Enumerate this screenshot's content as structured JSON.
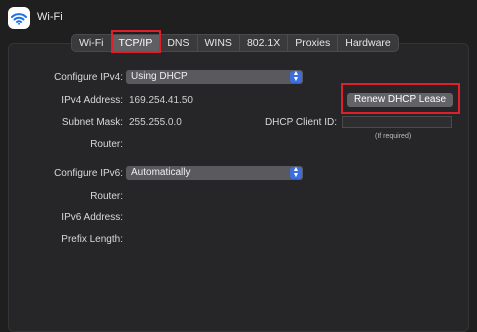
{
  "header": {
    "title": "Wi-Fi",
    "icon": "wifi-icon"
  },
  "tabs": [
    {
      "label": "Wi-Fi",
      "active": false
    },
    {
      "label": "TCP/IP",
      "active": true
    },
    {
      "label": "DNS",
      "active": false
    },
    {
      "label": "WINS",
      "active": false
    },
    {
      "label": "802.1X",
      "active": false
    },
    {
      "label": "Proxies",
      "active": false
    },
    {
      "label": "Hardware",
      "active": false
    }
  ],
  "ipv4": {
    "configure_label": "Configure IPv4:",
    "configure_value": "Using DHCP",
    "address_label": "IPv4 Address:",
    "address_value": "169.254.41.50",
    "subnet_label": "Subnet Mask:",
    "subnet_value": "255.255.0.0",
    "router_label": "Router:",
    "router_value": ""
  },
  "dhcp": {
    "renew_button": "Renew DHCP Lease",
    "client_id_label": "DHCP Client ID:",
    "client_id_value": "",
    "client_id_hint": "(If required)"
  },
  "ipv6": {
    "configure_label": "Configure IPv6:",
    "configure_value": "Automatically",
    "router_label": "Router:",
    "router_value": "",
    "address_label": "IPv6 Address:",
    "address_value": "",
    "prefix_label": "Prefix Length:",
    "prefix_value": ""
  },
  "colors": {
    "accent": "#3b6fe0",
    "highlight": "#e01f2b",
    "background": "#1f1f1f"
  }
}
